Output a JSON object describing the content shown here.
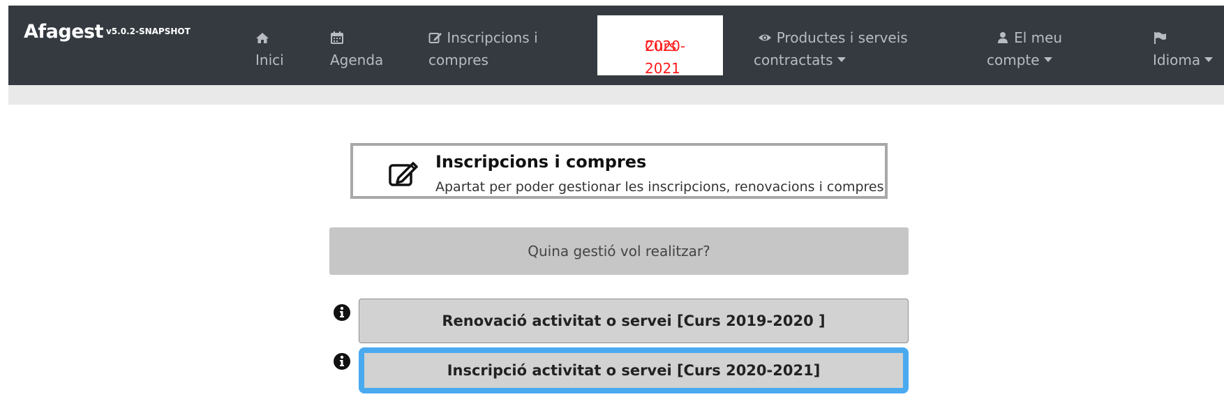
{
  "app": {
    "name": "Afagest",
    "version": "v5.0.2-SNAPSHOT"
  },
  "nav": {
    "inici": {
      "icon": "home-icon",
      "label": "Inici"
    },
    "agenda": {
      "icon": "calendar-icon",
      "label": "Agenda"
    },
    "inscripcions": {
      "icon": "edit-icon",
      "line1": "Inscripcions i",
      "line2": "compres"
    },
    "curs": {
      "line1": "Curs",
      "line2": "2020-2021",
      "color": "#ff1a1a"
    },
    "productes": {
      "icon": "eye-icon",
      "line1": "Productes i serveis",
      "line2": "contractats"
    },
    "compte": {
      "icon": "user-icon",
      "line1": "El meu",
      "line2": "compte"
    },
    "idioma": {
      "icon": "flag-icon",
      "label": "Idioma"
    }
  },
  "section": {
    "icon": "edit-icon",
    "title": "Inscripcions i compres",
    "subtitle": "Apartat per poder gestionar les inscripcions, renovacions i compres"
  },
  "question": "Quina gestió vol realitzar?",
  "actions": [
    {
      "label": "Renovació activitat o servei [Curs 2019-2020 ]",
      "icon": "info-icon"
    },
    {
      "label": "Inscripció activitat o servei [Curs 2020-2021]",
      "icon": "info-icon",
      "focused": true
    }
  ],
  "colors": {
    "navbar": "#343a40",
    "active_text": "#ff1a1a",
    "focus_ring": "#4aaaf0"
  }
}
